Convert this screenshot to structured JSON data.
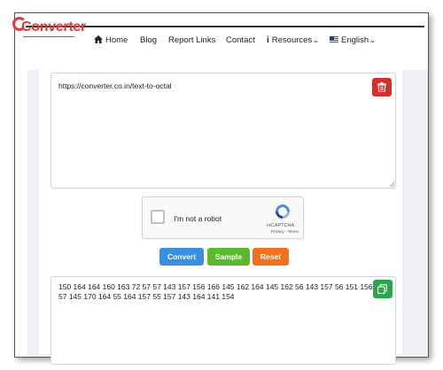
{
  "header": {
    "logo_text": "Converter",
    "nav": {
      "home": "Home",
      "blog": "Blog",
      "report_links": "Report Links",
      "contact": "Contact",
      "resources": "Resources",
      "language": "English"
    }
  },
  "input": {
    "value": "https://converter.co.in/text-to-octal"
  },
  "captcha": {
    "label": "I'm not a robot",
    "brand": "reCAPTCHA",
    "links": "Privacy - Terms"
  },
  "buttons": {
    "convert": "Convert",
    "sample": "Sample",
    "reset": "Reset"
  },
  "output": {
    "value": "150 164 164 160 163 72 57 57 143 157 156 166 145 162 164 145 162 56 143 157 56 151 156 57 145 170 164 55 164 157 55 157 143 164 141 154"
  },
  "colors": {
    "brand": "#e53935",
    "convert": "#3b8fe0",
    "sample": "#5cb82c",
    "reset": "#f2711c",
    "trash": "#d32f2f",
    "copy": "#2ea44f"
  }
}
